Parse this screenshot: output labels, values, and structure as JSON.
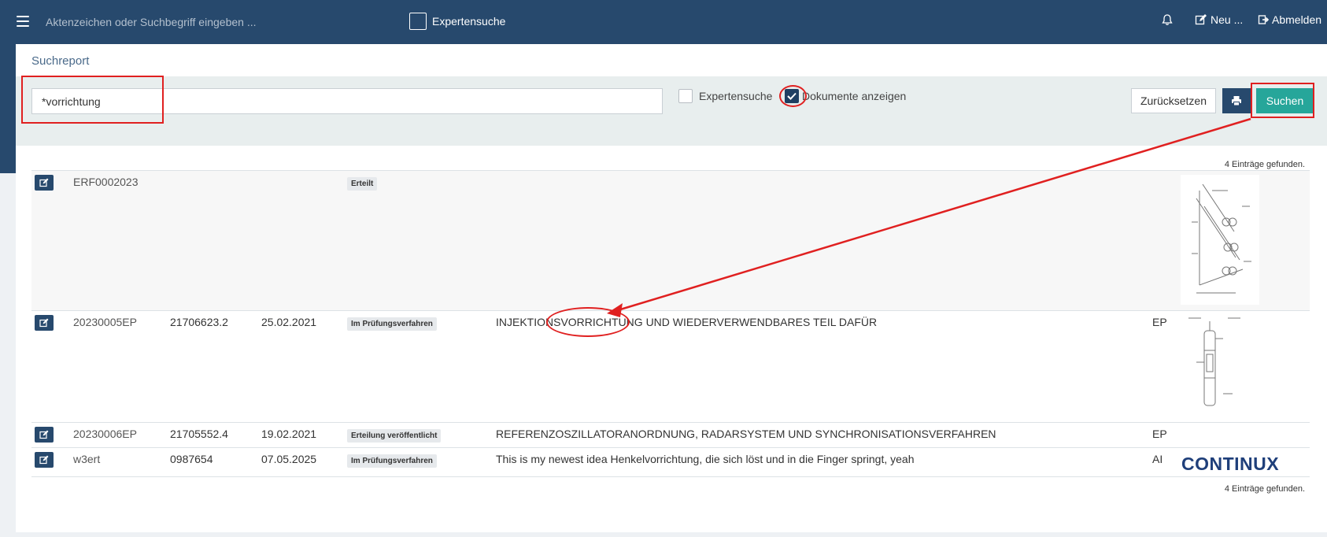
{
  "topbar": {
    "search_placeholder": "Aktenzeichen oder Suchbegriff eingeben ...",
    "expert_label": "Expertensuche",
    "new_label": "Neu ...",
    "logout_label": "Abmelden"
  },
  "report": {
    "title": "Suchreport",
    "search_value": "*vorrichtung",
    "expert_label": "Expertensuche",
    "show_docs_label": "Dokumente anzeigen",
    "show_docs_checked": true,
    "reset_label": "Zurücksetzen",
    "search_label": "Suchen",
    "count_text": "4 Einträge gefunden."
  },
  "rows": [
    {
      "az": "ERF0002023",
      "nr": "",
      "date": "",
      "status": "Erteilt",
      "title": "",
      "land": "",
      "thumb": "drawing-1"
    },
    {
      "az": "20230005EP",
      "nr": "21706623.2",
      "date": "25.02.2021",
      "status": "Im Prüfungsverfahren",
      "title": "INJEKTIONSVORRICHTUNG UND WIEDERVERWENDBARES TEIL DAFÜR",
      "land": "EP",
      "thumb": "drawing-2"
    },
    {
      "az": "20230006EP",
      "nr": "21705552.4",
      "date": "19.02.2021",
      "status": "Erteilung veröffentlicht",
      "title": "REFERENZOSZILLATORANORDNUNG, RADARSYSTEM UND SYNCHRONISATIONSVERFAHREN",
      "land": "EP",
      "thumb": ""
    },
    {
      "az": "w3ert",
      "nr": "0987654",
      "date": "07.05.2025",
      "status": "Im Prüfungsverfahren",
      "title": "This is my newest idea Henkelvorrichtung, die sich löst und in die Finger springt, yeah",
      "land": "AI",
      "thumb": "logo"
    }
  ],
  "logo_text": "CONTINUX",
  "colors": {
    "topbar": "#27496d",
    "accent": "#26a69a",
    "annotation": "#e02020"
  }
}
